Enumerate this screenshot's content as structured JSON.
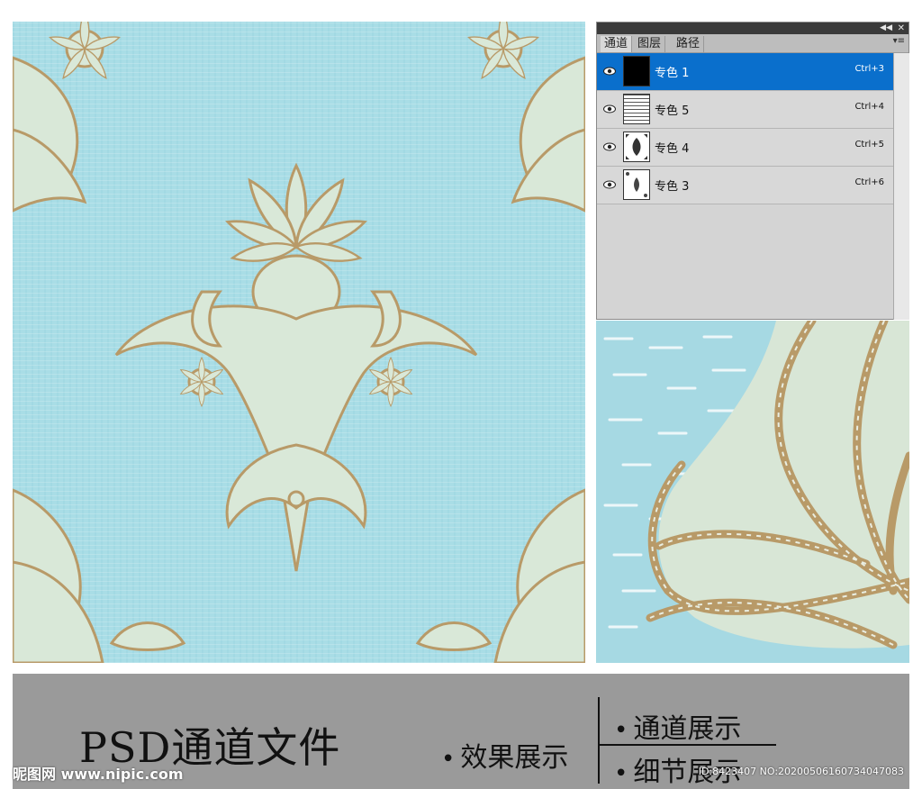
{
  "colors": {
    "pattern_bg": "#a9dde6",
    "ornament_fill": "#d9e8d8",
    "ornament_outline": "#b89a68",
    "selected_row": "#0a6fcc",
    "banner_bg": "#9a9a9a"
  },
  "panel": {
    "tabs": [
      {
        "label": "通道",
        "active": true
      },
      {
        "label": "图层",
        "active": false
      },
      {
        "label": "路径",
        "active": false
      }
    ],
    "rows": [
      {
        "name": "专色 1",
        "shortcut": "Ctrl+3",
        "selected": true,
        "thumb": "solid-black"
      },
      {
        "name": "专色 5",
        "shortcut": "Ctrl+4",
        "selected": false,
        "thumb": "dashes"
      },
      {
        "name": "专色 4",
        "shortcut": "Ctrl+5",
        "selected": false,
        "thumb": "ornament"
      },
      {
        "name": "专色 3",
        "shortcut": "Ctrl+6",
        "selected": false,
        "thumb": "ornament-small"
      }
    ]
  },
  "banner": {
    "title": "PSD通道文件",
    "effect": "效果展示",
    "channels": "通道展示",
    "detail": "细节展示"
  },
  "watermark": {
    "site": "昵图网 www.nipic.com",
    "id": "ID:8423407 NO:20200506160734047083"
  }
}
